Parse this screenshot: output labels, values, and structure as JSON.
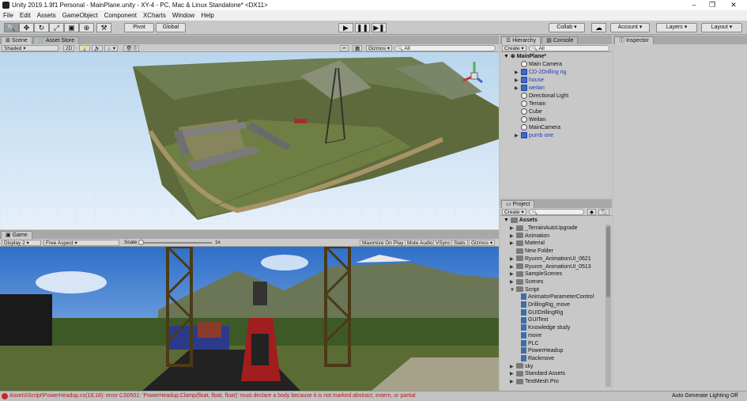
{
  "window": {
    "title": "Unity 2019.1.9f1 Personal - MainPlane.unity - XY-4 - PC, Mac & Linux Standalone* <DX11>"
  },
  "menu": [
    "File",
    "Edit",
    "Assets",
    "GameObject",
    "Component",
    "XCharts",
    "Window",
    "Help"
  ],
  "toolbar": {
    "pivot": "Pivot",
    "global": "Global",
    "collab": "Collab ▾",
    "account": "Account",
    "layers": "Layers",
    "layout": "Layout"
  },
  "scene": {
    "tab": "Scene",
    "tab2": "Asset Store",
    "shading": "Shaded",
    "mode2d": "2D",
    "gizmos": "Gizmos ▾",
    "search": "All",
    "persp": "0"
  },
  "game": {
    "tab": "Game",
    "display": "Display 2",
    "aspect": "Free Aspect",
    "scale_label": "Scale",
    "scale_val": "1x",
    "maximize": "Maximize On Play",
    "mute": "Mute Audio",
    "vsync": "VSync",
    "stats": "Stats",
    "gizmos": "Gizmos ▾"
  },
  "hierarchy": {
    "tab": "Hierarchy",
    "tab2": "Console",
    "create": "Create ▾",
    "search": "All",
    "scene": "MainPlane*",
    "items": [
      {
        "label": "Main Camera",
        "prefab": false,
        "arrow": false
      },
      {
        "label": "CD-2Drilling rig",
        "prefab": true,
        "arrow": true
      },
      {
        "label": "house",
        "prefab": true,
        "arrow": true
      },
      {
        "label": "weilan",
        "prefab": true,
        "arrow": true
      },
      {
        "label": "Directional Light",
        "prefab": false,
        "arrow": false
      },
      {
        "label": "Terrain",
        "prefab": false,
        "arrow": false
      },
      {
        "label": "Cube",
        "prefab": false,
        "arrow": false
      },
      {
        "label": "Weilan",
        "prefab": false,
        "arrow": false
      },
      {
        "label": "MainCamera",
        "prefab": false,
        "arrow": false
      },
      {
        "label": "pumb one",
        "prefab": true,
        "arrow": true
      }
    ]
  },
  "inspector": {
    "tab": "Inspector"
  },
  "project": {
    "tab": "Project",
    "create": "Create ▾",
    "root": "Assets",
    "items": [
      {
        "label": "_TerrainAutoUpgrade",
        "type": "folder",
        "depth": 1,
        "arrow": "▶"
      },
      {
        "label": "Animation",
        "type": "folder",
        "depth": 1,
        "arrow": "▶"
      },
      {
        "label": "Material",
        "type": "folder",
        "depth": 1,
        "arrow": "▶"
      },
      {
        "label": "New Folder",
        "type": "folder",
        "depth": 1,
        "arrow": ""
      },
      {
        "label": "Ryunm_AnimationUI_0621",
        "type": "folder",
        "depth": 1,
        "arrow": "▶"
      },
      {
        "label": "Ryunm_AnimationUI_0513",
        "type": "folder",
        "depth": 1,
        "arrow": "▶"
      },
      {
        "label": "SampleScenes",
        "type": "folder",
        "depth": 1,
        "arrow": "▶"
      },
      {
        "label": "Scenes",
        "type": "folder",
        "depth": 1,
        "arrow": "▶"
      },
      {
        "label": "Script",
        "type": "folder",
        "depth": 1,
        "arrow": "▼"
      },
      {
        "label": "AnimatorParameterControl",
        "type": "file",
        "depth": 2,
        "arrow": ""
      },
      {
        "label": "DrillingRig_move",
        "type": "file",
        "depth": 2,
        "arrow": ""
      },
      {
        "label": "GUIDrillingRig",
        "type": "file",
        "depth": 2,
        "arrow": ""
      },
      {
        "label": "GUIText",
        "type": "file",
        "depth": 2,
        "arrow": ""
      },
      {
        "label": "Knowledge study",
        "type": "file",
        "depth": 2,
        "arrow": ""
      },
      {
        "label": "move",
        "type": "file",
        "depth": 2,
        "arrow": ""
      },
      {
        "label": "PLC",
        "type": "file",
        "depth": 2,
        "arrow": ""
      },
      {
        "label": "PowerHeadup",
        "type": "file",
        "depth": 2,
        "arrow": ""
      },
      {
        "label": "Rackmove",
        "type": "file",
        "depth": 2,
        "arrow": ""
      },
      {
        "label": "sky",
        "type": "folder",
        "depth": 1,
        "arrow": "▶"
      },
      {
        "label": "Standard Assets",
        "type": "folder",
        "depth": 1,
        "arrow": "▶"
      },
      {
        "label": "TextMesh Pro",
        "type": "folder",
        "depth": 1,
        "arrow": "▶"
      }
    ]
  },
  "status": {
    "error": "Assets\\Script\\PowerHeadup.cs(18,18): error CS0501: 'PowerHeadup.Clamp(float, float, float)' must declare a body because it is not marked abstract, extern, or partial",
    "lighting": "Auto Generate Lighting Off"
  }
}
